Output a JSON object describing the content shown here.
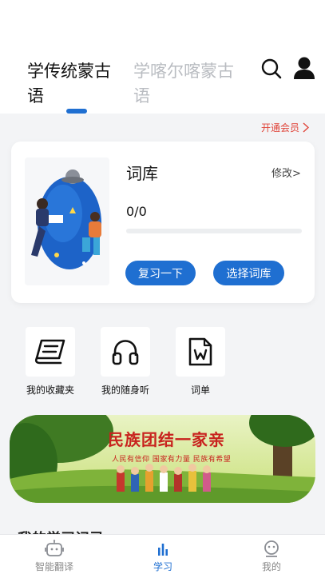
{
  "header": {
    "tabs": [
      {
        "label": "学传统蒙古语",
        "active": true
      },
      {
        "label": "学喀尔喀蒙古语",
        "active": false
      }
    ],
    "icons": [
      "search-icon",
      "user-icon"
    ]
  },
  "vip": {
    "label": "开通会员"
  },
  "vocab_card": {
    "title": "词库",
    "edit_label": "修改>",
    "progress_text": "0/0",
    "progress_fraction": 0,
    "review_button": "复习一下",
    "choose_button": "选择词库"
  },
  "shortcuts": [
    {
      "label": "我的收藏夹",
      "icon": "book-icon"
    },
    {
      "label": "我的随身听",
      "icon": "headphones-icon"
    },
    {
      "label": "词单",
      "icon": "word-doc-icon"
    }
  ],
  "banner": {
    "title": "民族团结一家亲",
    "subtitle": "人民有信仰  国家有力量  民族有希望"
  },
  "section_peek": {
    "label": "我的学习记录"
  },
  "bottom_nav": [
    {
      "label": "智能翻译",
      "icon": "robot-icon",
      "active": false
    },
    {
      "label": "学习",
      "icon": "chart-icon",
      "active": true
    },
    {
      "label": "我的",
      "icon": "profile-icon",
      "active": false
    }
  ],
  "colors": {
    "accent": "#1f6fd1",
    "vip": "#e0453a",
    "background": "#f3f4f6"
  }
}
